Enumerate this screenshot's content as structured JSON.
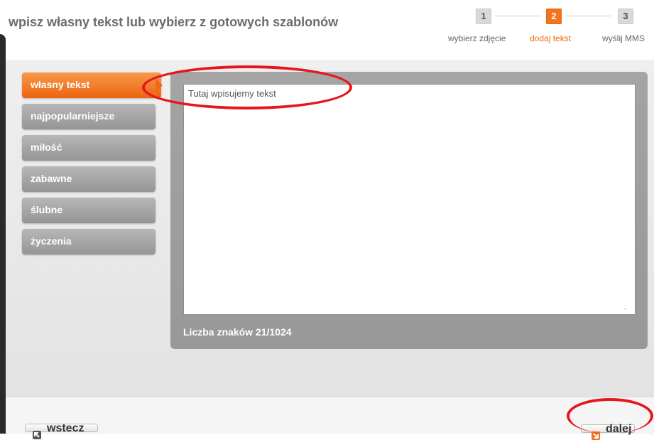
{
  "header": {
    "title": "wpisz własny tekst lub wybierz z gotowych szablonów",
    "steps": [
      {
        "num": "1",
        "label": "wybierz zdjęcie",
        "active": false
      },
      {
        "num": "2",
        "label": "dodaj tekst",
        "active": true
      },
      {
        "num": "3",
        "label": "wyślij MMS",
        "active": false
      }
    ]
  },
  "sidebar": {
    "items": [
      {
        "label": "własny tekst",
        "active": true
      },
      {
        "label": "najpopularniejsze",
        "active": false
      },
      {
        "label": "miłość",
        "active": false
      },
      {
        "label": "zabawne",
        "active": false
      },
      {
        "label": "ślubne",
        "active": false
      },
      {
        "label": "życzenia",
        "active": false
      }
    ]
  },
  "editor": {
    "value": "Tutaj wpisujemy tekst",
    "char_count": "Liczba znaków 21/1024"
  },
  "footer": {
    "back_label": "wstecz",
    "next_label": "dalej"
  },
  "colors": {
    "accent": "#f3741d",
    "annotation": "#e5161c"
  }
}
